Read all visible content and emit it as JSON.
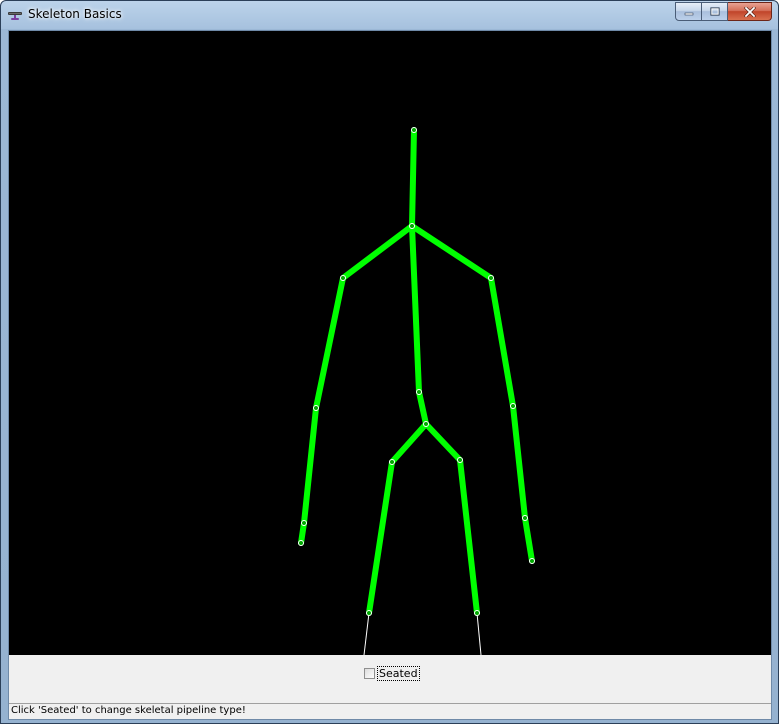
{
  "window": {
    "title": "Skeleton Basics",
    "icon": "kinect-sensor-icon"
  },
  "caption": {
    "minimize_icon": "minimize-icon",
    "maximize_icon": "maximize-icon",
    "close_icon": "close-icon"
  },
  "viewport": {
    "background": "#000000",
    "bone_color": "#00ff00",
    "inferred_bone_color": "#ffffff",
    "joint_color": "#00ff00"
  },
  "controls": {
    "seated_label": "Seated",
    "seated_checked": false
  },
  "status": {
    "text": "Click 'Seated' to change skeletal pipeline type!"
  }
}
